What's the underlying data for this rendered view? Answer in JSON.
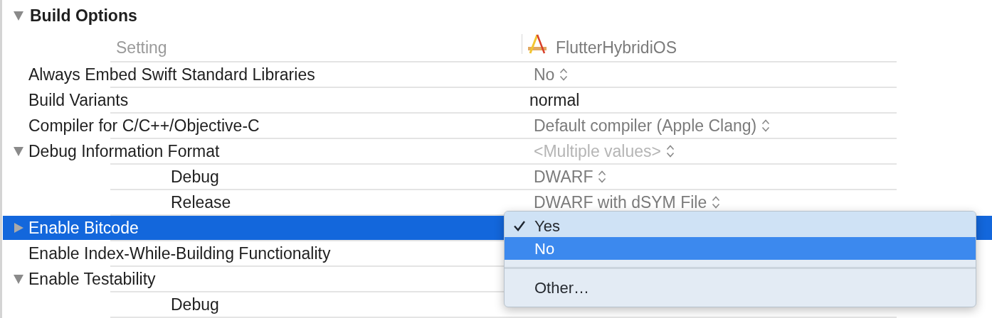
{
  "section": {
    "title": "Build Options",
    "expanded": true
  },
  "header": {
    "setting_label": "Setting",
    "target": "FlutterHybridiOS"
  },
  "rows": [
    {
      "kind": "setting",
      "label": "Always Embed Swift Standard Libraries",
      "value": "No",
      "modified": false,
      "mixed": false,
      "popup": true,
      "selected": false
    },
    {
      "kind": "setting",
      "label": "Build Variants",
      "value": "normal",
      "modified": true,
      "mixed": false,
      "popup": false,
      "selected": false
    },
    {
      "kind": "setting",
      "label": "Compiler for C/C++/Objective-C",
      "value": "Default compiler (Apple Clang)",
      "modified": false,
      "mixed": false,
      "popup": true,
      "selected": false
    },
    {
      "kind": "group",
      "label": "Debug Information Format",
      "expanded": true,
      "value": "<Multiple values>",
      "mixed": true,
      "popup": true,
      "selected": false
    },
    {
      "kind": "config",
      "label": "Debug",
      "value": "DWARF",
      "modified": false,
      "mixed": false,
      "popup": true,
      "selected": false
    },
    {
      "kind": "config",
      "label": "Release",
      "value": "DWARF with dSYM File",
      "modified": false,
      "mixed": false,
      "popup": true,
      "selected": false
    },
    {
      "kind": "group",
      "label": "Enable Bitcode",
      "expanded": false,
      "selected": true
    },
    {
      "kind": "setting",
      "label": "Enable Index-While-Building Functionality",
      "selected": false
    },
    {
      "kind": "group",
      "label": "Enable Testability",
      "expanded": true,
      "selected": false
    },
    {
      "kind": "config",
      "label": "Debug",
      "selected": false
    }
  ],
  "menu": {
    "items": [
      {
        "kind": "option",
        "label": "Yes",
        "checked": true,
        "highlighted": false
      },
      {
        "kind": "option",
        "label": "No",
        "checked": false,
        "highlighted": true
      },
      {
        "kind": "separator"
      },
      {
        "kind": "option",
        "label": "Other…",
        "checked": false,
        "highlighted": false
      }
    ]
  }
}
